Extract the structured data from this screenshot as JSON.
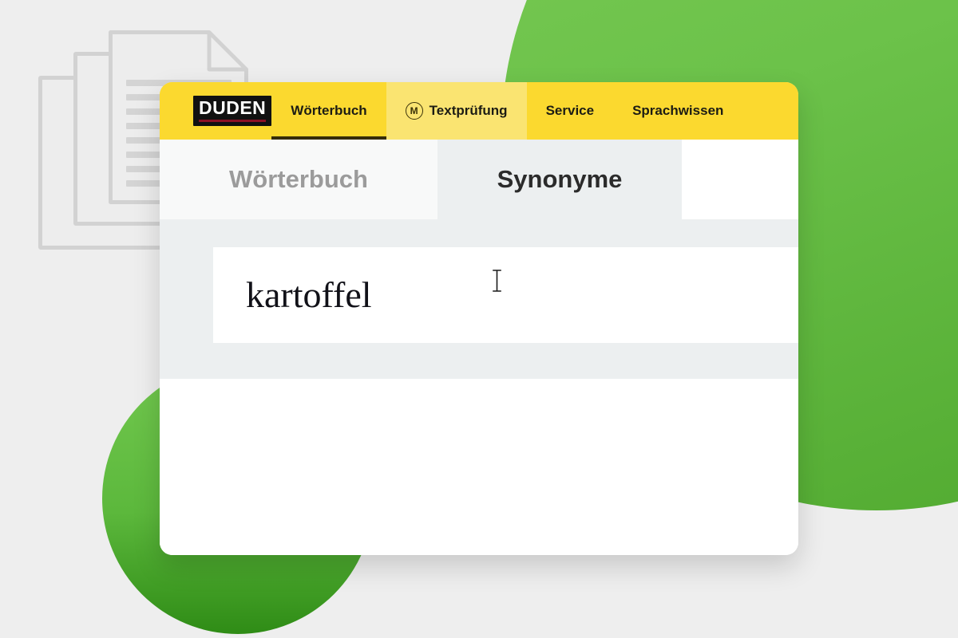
{
  "background": {
    "page_bg_color": "#eeeeee",
    "green_accent_color": "#6cc24a",
    "green_dark_color": "#2f8c16",
    "doc_icon_name": "stacked-documents-illustration",
    "doc_line_widths": [
      "100%",
      "100%",
      "100%",
      "100%",
      "62%",
      "100%",
      "100%",
      "72%"
    ]
  },
  "topnav": {
    "brand": {
      "name": "DUDEN",
      "bg_color": "#111111",
      "text_color": "#ffffff",
      "rule_color": "#8c1024"
    },
    "bg_color": "#fbd92f",
    "bg_light_color": "#fae471",
    "items": [
      {
        "label": "Wörterbuch",
        "active": true,
        "icon": null
      },
      {
        "label": "Textprüfung",
        "active": false,
        "icon": "circled-m-icon",
        "icon_letter": "M"
      },
      {
        "label": "Service",
        "active": false,
        "icon": null
      },
      {
        "label": "Sprachwissen",
        "active": false,
        "icon": null
      }
    ]
  },
  "tabs": [
    {
      "label": "Wörterbuch",
      "active": false
    },
    {
      "label": "Synonyme",
      "active": true
    }
  ],
  "search": {
    "value": "kartoffel",
    "placeholder": "",
    "cursor_icon": "text-ibeam-cursor"
  }
}
